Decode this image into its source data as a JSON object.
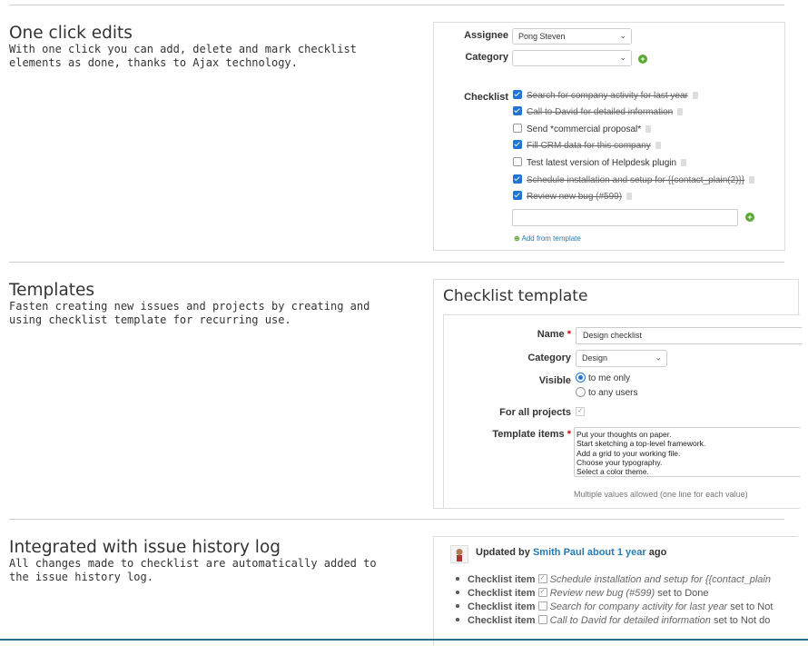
{
  "sections": [
    {
      "title": "One click edits",
      "description": "With one click you can add, delete and mark checklist elements as done, thanks to Ajax technology."
    },
    {
      "title": "Templates",
      "description": "Fasten creating new issues and projects by creating and using checklist template for recurring use."
    },
    {
      "title": "Integrated with issue history log",
      "description": "All changes made to checklist are automatically added to the issue history log."
    }
  ],
  "edit_panel": {
    "assignee_label": "Assignee",
    "assignee_value": "Pong Steven",
    "category_label": "Category",
    "category_value": "",
    "checklist_label": "Checklist",
    "items": [
      {
        "text": "Search for company activity for last year",
        "done": true
      },
      {
        "text": "Call to David for detailed information",
        "done": true
      },
      {
        "text": "Send *commercial proposal*",
        "done": false
      },
      {
        "text": "Fill CRM data for this company",
        "done": true
      },
      {
        "text": "Test latest version of Helpdesk plugin",
        "done": false
      },
      {
        "text": "Schedule installation and setup for {{contact_plain(2)}}",
        "done": true
      },
      {
        "text": "Review new bug (#599)",
        "done": true
      }
    ],
    "new_item_value": "",
    "add_from_template": "Add from template"
  },
  "template_panel": {
    "title": "Checklist template",
    "name_label": "Name",
    "name_value": "Design checklist",
    "category_label": "Category",
    "category_value": "Design",
    "visible_label": "Visible",
    "visible_options": [
      "to me only",
      "to any users"
    ],
    "visible_selected": 0,
    "all_projects_label": "For all projects",
    "all_projects_checked": true,
    "required_mark": "*",
    "items_label": "Template items",
    "items_lines": [
      "Put your thoughts on paper.",
      "Start sketching a top-level framework.",
      "Add a grid to your working file.",
      "Choose your typography.",
      "Select a color theme."
    ],
    "hint": "Multiple values allowed (one line for each value)"
  },
  "history_panel": {
    "updated_by": "Updated by",
    "author": "Smith Paul",
    "time_ago": "about 1 year",
    "ago": "ago",
    "entries": [
      {
        "label": "Checklist item",
        "checked": true,
        "text": "Schedule installation and setup for {{contact_plain",
        "suffix": ""
      },
      {
        "label": "Checklist item",
        "checked": true,
        "text": "Review new bug (#599)",
        "suffix": "set to Done"
      },
      {
        "label": "Checklist item",
        "checked": false,
        "text": "Search for company activity for last year",
        "suffix": "set to Not"
      },
      {
        "label": "Checklist item",
        "checked": false,
        "text": "Call to David for detailed information",
        "suffix": "set to Not do"
      }
    ]
  },
  "colors": {
    "accent_blue": "#1f74d9",
    "link": "#2a79b0",
    "add_green": "#5aa832"
  },
  "icons": {
    "chevron": "chevron-down-icon",
    "add": "plus-circle-icon",
    "delete": "trash-icon",
    "avatar": "avatar"
  }
}
